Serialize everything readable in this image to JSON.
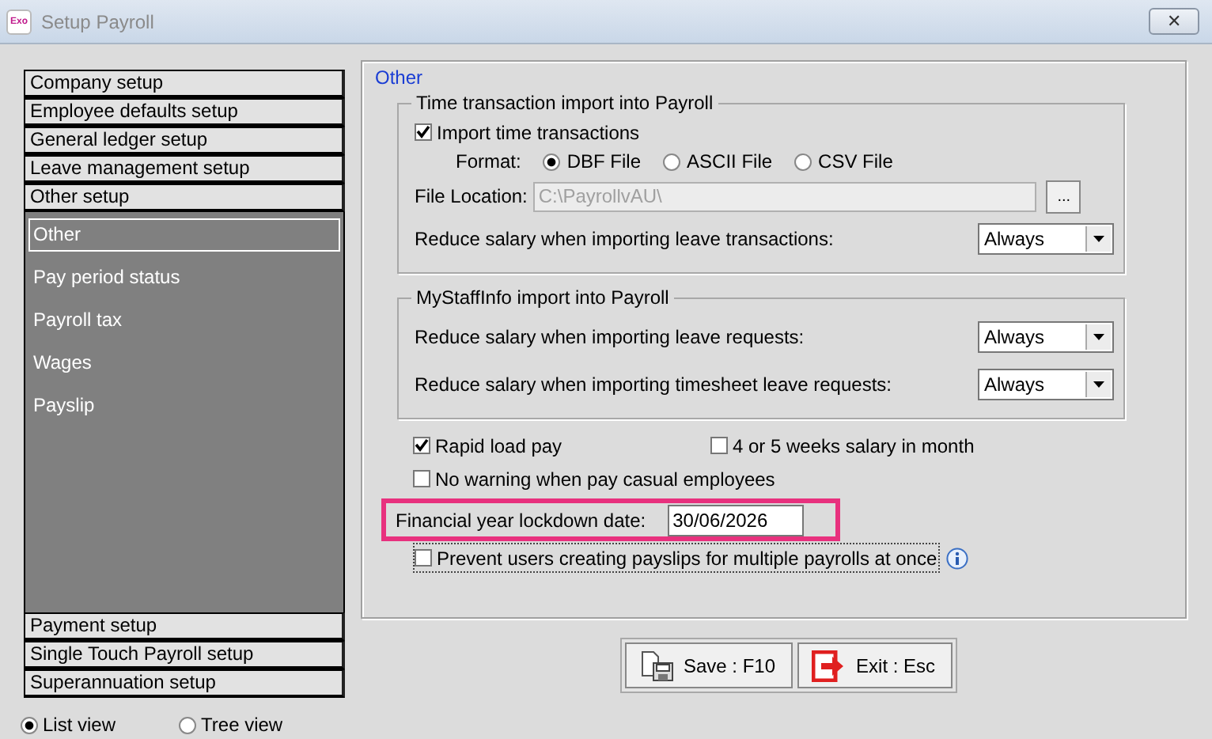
{
  "window": {
    "title": "Setup Payroll",
    "app_badge": "Exo",
    "close_glyph": "✕"
  },
  "sidebar": {
    "top_sections": [
      {
        "label": "Company setup"
      },
      {
        "label": "Employee defaults setup"
      },
      {
        "label": "General ledger setup"
      },
      {
        "label": "Leave management setup"
      },
      {
        "label": "Other setup"
      }
    ],
    "items": [
      {
        "label": "Other",
        "selected": true
      },
      {
        "label": "Pay period status",
        "selected": false
      },
      {
        "label": "Payroll tax",
        "selected": false
      },
      {
        "label": "Wages",
        "selected": false
      },
      {
        "label": "Payslip",
        "selected": false
      }
    ],
    "bottom_sections": [
      {
        "label": "Payment setup"
      },
      {
        "label": "Single Touch Payroll setup"
      },
      {
        "label": "Superannuation setup"
      }
    ],
    "views": [
      {
        "label": "List view",
        "selected": true
      },
      {
        "label": "Tree view",
        "selected": false
      }
    ]
  },
  "panel": {
    "title": "Other",
    "time_import": {
      "title": "Time transaction import into Payroll",
      "import_label": "Import time transactions",
      "import_checked": true,
      "format_label": "Format:",
      "formats": [
        {
          "label": "DBF File",
          "selected": true
        },
        {
          "label": "ASCII File",
          "selected": false
        },
        {
          "label": "CSV File",
          "selected": false
        }
      ],
      "file_location_label": "File Location:",
      "file_location": "C:\\PayrollvAU\\",
      "file_location_disabled": true,
      "browse_label": "...",
      "reduce_label": "Reduce salary when importing leave transactions:",
      "reduce_value": "Always"
    },
    "mystaffinfo": {
      "title": "MyStaffInfo import into Payroll",
      "rows": [
        {
          "label": "Reduce salary when importing leave requests:",
          "value": "Always"
        },
        {
          "label": "Reduce salary when importing timesheet leave requests:",
          "value": "Always"
        }
      ]
    },
    "options": [
      {
        "label": "Rapid load pay",
        "checked": true
      },
      {
        "label": "4 or 5 weeks salary in month",
        "checked": false
      },
      {
        "label": "No warning when pay casual employees",
        "checked": false
      }
    ],
    "lockdown": {
      "label": "Financial year lockdown date:",
      "value": "30/06/2026",
      "highlighted": true
    },
    "prevent": {
      "label": "Prevent users creating payslips for multiple payrolls at once",
      "checked": false,
      "focused": true
    }
  },
  "buttons": [
    {
      "kind": "save",
      "label": "Save : F10"
    },
    {
      "kind": "exit",
      "label": "Exit : Esc"
    }
  ]
}
